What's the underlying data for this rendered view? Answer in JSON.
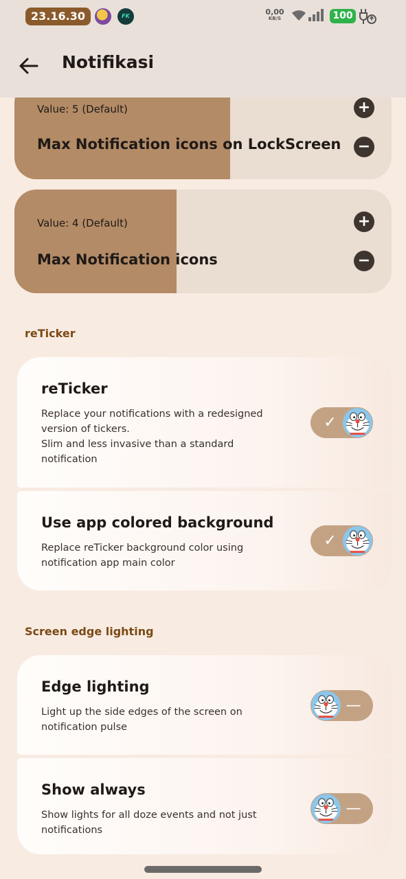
{
  "status_bar": {
    "time": "23.16.30",
    "app_icon_1": "sticker-avatar-icon",
    "app_icon_2_text": "FK",
    "net_speed_value": "0,00",
    "net_speed_unit": "KB/S",
    "battery_level": "100",
    "icons": [
      "wifi-icon",
      "signal-icon",
      "charging-plug-icon"
    ]
  },
  "app_bar": {
    "back_icon": "arrow-left-icon",
    "title": "Notifikasi"
  },
  "sliders": [
    {
      "value_label": "Value: 5 (Default)",
      "title": "Max Notification icons on LockScreen",
      "plus_label": "+",
      "minus_label": "−"
    },
    {
      "value_label": "Value: 4 (Default)",
      "title": "Max Notification icons",
      "plus_label": "+",
      "minus_label": "−"
    }
  ],
  "sections": [
    {
      "header": "reTicker",
      "items": [
        {
          "title": "reTicker",
          "description": [
            "Replace your notifications with a redesigned",
            "version of tickers.",
            "Slim and less invasive than a standard",
            "notification"
          ],
          "enabled": true
        },
        {
          "title": "Use app colored background",
          "description": [
            "Replace reTicker background color using",
            "notification app main color"
          ],
          "enabled": true
        }
      ]
    },
    {
      "header": "Screen edge lighting",
      "items": [
        {
          "title": "Edge lighting",
          "description": [
            "Light up the side edges of the screen on",
            "notification pulse"
          ],
          "enabled": false
        },
        {
          "title": "Show always",
          "description": [
            "Show lights for all doze events and not just",
            "notifications"
          ],
          "enabled": false
        }
      ]
    }
  ],
  "toggle_marks": {
    "on": "✓",
    "off": "—"
  },
  "colors": {
    "accent": "#8b5a2b",
    "slider_fill": "#b38b66",
    "slider_track": "#eaddd1",
    "section_header": "#7b4a15",
    "toggle_track": "#c3a284",
    "background": "#f8ebe2"
  }
}
